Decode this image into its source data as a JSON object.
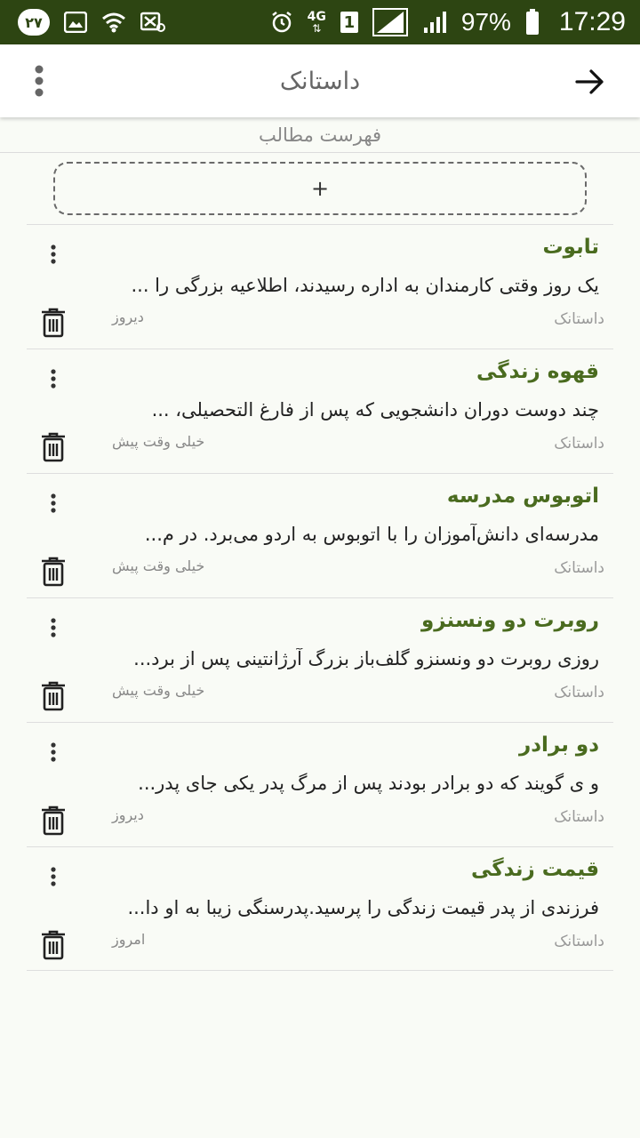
{
  "status_bar": {
    "notification_count": "۲۷",
    "network_label": "4G",
    "sim_label": "1",
    "battery_percent": "97%",
    "time": "17:29",
    "icons": [
      "notification-badge",
      "image-icon",
      "wifi-icon",
      "data-off-icon",
      "alarm-icon",
      "signal-icon",
      "signal-icon",
      "battery-icon"
    ]
  },
  "app_bar": {
    "title": "داستانک",
    "icons": [
      "more-vertical-icon",
      "arrow-right-icon"
    ]
  },
  "section": {
    "title": "فهرست مطالب"
  },
  "add_button": {
    "label": "+"
  },
  "stories": [
    {
      "title": "تابوت",
      "excerpt": "یک روز وقتی کارمندان به اداره رسیدند، اطلاعیه بزرگی را ...",
      "category": "داستانک",
      "date": "دیروز"
    },
    {
      "title": "قهوه زندگی",
      "excerpt": "چند دوست دوران دانشجویی که پس از فارغ التحصیلی، ...",
      "category": "داستانک",
      "date": "خیلی وقت پیش"
    },
    {
      "title": "اتوبوس مدرسه",
      "excerpt": "مدرسه‌ای دانش‌آموزان را با اتوبوس به اردو می‌برد. در م...",
      "category": "داستانک",
      "date": "خیلی وقت پیش"
    },
    {
      "title": "روبرت دو ونسنزو",
      "excerpt": "روزی روبرت دو ونسنزو گلف‌باز بزرگ آرژانتینی پس از برد...",
      "category": "داستانک",
      "date": "خیلی وقت پیش"
    },
    {
      "title": "دو برادر",
      "excerpt": "و ی گویند که دو برادر بودند پس از مرگ پدر یکی جای پدر...",
      "category": "داستانک",
      "date": "دیروز"
    },
    {
      "title": "قیمت زندگی",
      "excerpt": "فرزندی از پدر قیمت زندگی را پرسید.پدرسنگی زیبا به او دا...",
      "category": "داستانک",
      "date": "امروز"
    }
  ],
  "colors": {
    "status_bar": "#2d4512",
    "title_green": "#4a6b1f"
  }
}
